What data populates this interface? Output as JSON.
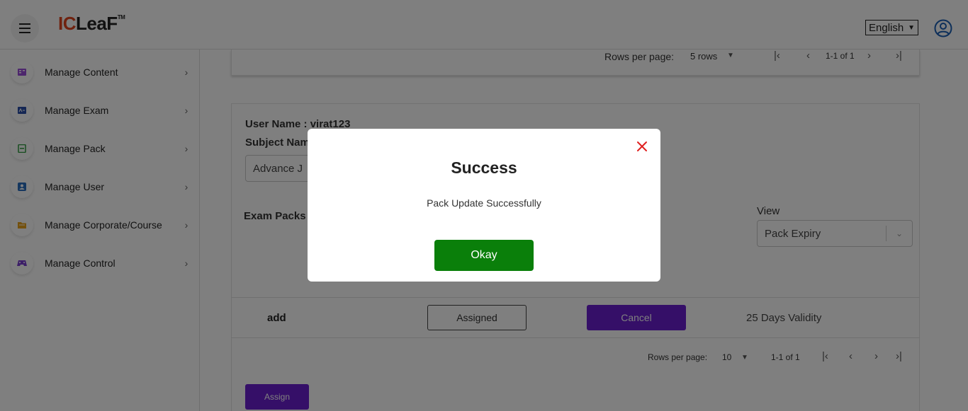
{
  "header": {
    "logo_prefix": "IC",
    "logo_main": "LeaF",
    "logo_tm": "TM",
    "language": "English"
  },
  "sidebar": {
    "items": [
      {
        "label": "Manage Content",
        "icon": "book-icon",
        "color": "#9b4ddb"
      },
      {
        "label": "Manage Exam",
        "icon": "exam-icon",
        "color": "#2b4fa8"
      },
      {
        "label": "Manage Pack",
        "icon": "pack-icon",
        "color": "#2e9b3f"
      },
      {
        "label": "Manage User",
        "icon": "user-icon",
        "color": "#2b6fbf"
      },
      {
        "label": "Manage Corporate/Course",
        "icon": "folder-icon",
        "color": "#e8a21c"
      },
      {
        "label": "Manage Control",
        "icon": "gamepad-icon",
        "color": "#7a3fd1"
      }
    ]
  },
  "top_pager": {
    "rows_label": "Rows per page:",
    "rows_value": "5 rows",
    "range": "1-1 of 1"
  },
  "main": {
    "user_name": "User Name : virat123",
    "subject_name_label": "Subject Nam",
    "subject_value": "Advance J",
    "exam_packs_label": "Exam Packs",
    "view_label": "View",
    "view_value": "Pack Expiry",
    "row": {
      "name": "add",
      "assigned_label": "Assigned",
      "cancel_label": "Cancel",
      "validity": "25 Days Validity"
    },
    "assign_label": "Assign"
  },
  "bottom_pager": {
    "rows_label": "Rows per page:",
    "rows_value": "10",
    "range": "1-1 of 1"
  },
  "modal": {
    "title": "Success",
    "message": "Pack Update Successfully",
    "ok_label": "Okay"
  },
  "colors": {
    "accent_purple": "#6a1fd1",
    "ok_green": "#0a7f0a",
    "close_red": "#e0201f",
    "logo_orange": "#e0451f",
    "profile_blue": "#1a5fb4"
  }
}
